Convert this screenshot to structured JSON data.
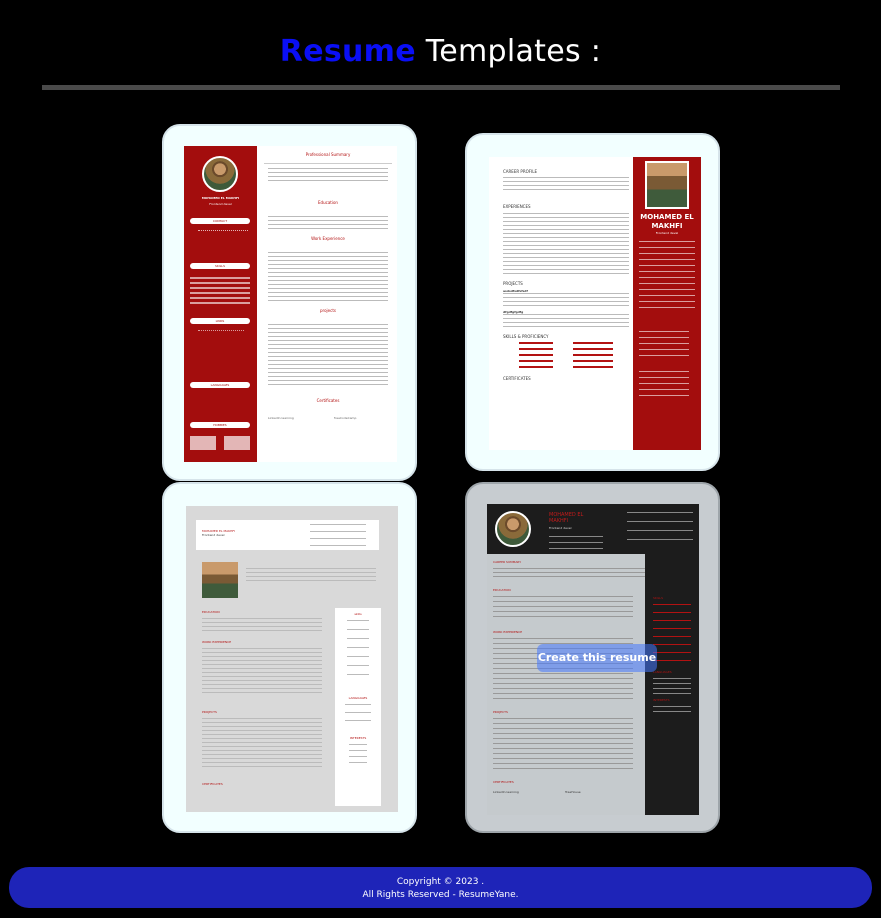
{
  "header": {
    "title_accent": "Resume",
    "title_rest": " Templates :"
  },
  "templates": [
    {
      "name": "MOHAMED EL MAKHFI",
      "role": "Frontend devel",
      "sections": [
        "CONTACT",
        "SKILLS",
        "LINKS",
        "LANGUAGES",
        "HOBBIES"
      ],
      "main_sections": [
        "Professional Summary",
        "Education",
        "Work Experience",
        "projects",
        "Certificates"
      ],
      "cert_left": "LinkedIn learning",
      "cert_right": "freeCodeCamp"
    },
    {
      "name": "MOHAMED EL MAKHFI",
      "role": "Frontend devel",
      "sections": [
        "CAREER PROFILE",
        "EXPERIENCES",
        "PROJECTS",
        "SKILLS & PROFICIENCY",
        "CERTIFICATES"
      ],
      "project_1": "asdsdfsdfsfsdf",
      "project_2": "dfgdfgfgdfg"
    },
    {
      "name": "MOHAMED EL MAKHFI",
      "role": "Frontend devel",
      "sections": [
        "EDUCATION",
        "WORK EXPERIENCE",
        "PROJECTS",
        "CERTIFICATES"
      ],
      "side_sections": [
        "skills",
        "LANGUAGES",
        "INTERESTS"
      ]
    },
    {
      "name": "MOHAMED EL MAKHFI",
      "role": "Frontend devel",
      "sections": [
        "CAREER SUMMARY",
        "EDUCATION",
        "WORK EXPERIENCE",
        "PROJECTS",
        "CERTIFICATES"
      ],
      "side_sections": [
        "SKILLS",
        "LANGUAGES",
        "INTERESTS"
      ],
      "cert_left": "LinkedIn learning",
      "cert_right": "TreeHouse",
      "cta": "Create this resume"
    }
  ],
  "footer": {
    "line1": "Copyright © 2023 .",
    "line2": "All Rights Reserved   - ResumeYane."
  }
}
